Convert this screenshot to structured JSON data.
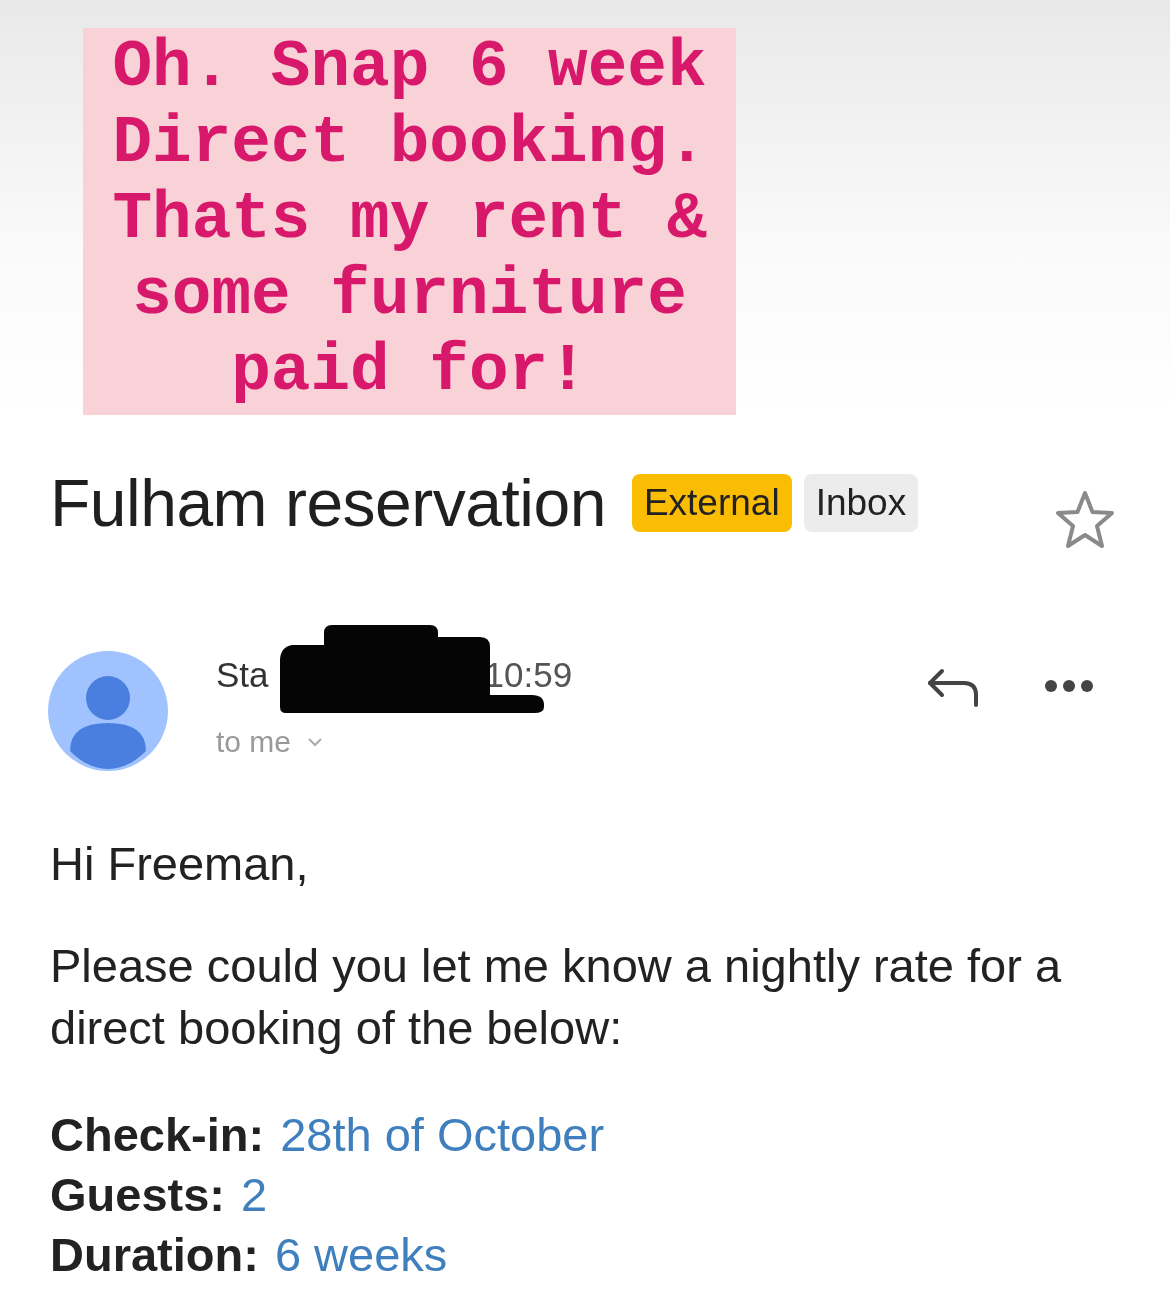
{
  "caption": {
    "text": "Oh. Snap 6 week\nDirect booking.\nThats my rent &\nsome furniture\npaid for!"
  },
  "email": {
    "subject": "Fulham reservation",
    "labels": [
      {
        "text": "External",
        "kind": "external"
      },
      {
        "text": "Inbox",
        "kind": "folder"
      }
    ],
    "starred": false,
    "sender": {
      "name": "Sta",
      "time": "10:59",
      "recipient": "to me",
      "redacted": true
    },
    "greeting": "Hi Freeman,",
    "paragraph": "Please could you let me know a nightly rate for a direct booking of the below:",
    "details": [
      {
        "label": "Check-in:",
        "value": "28th of October"
      },
      {
        "label": "Guests:",
        "value": "2"
      },
      {
        "label": "Duration:",
        "value": "6 weeks"
      }
    ]
  }
}
